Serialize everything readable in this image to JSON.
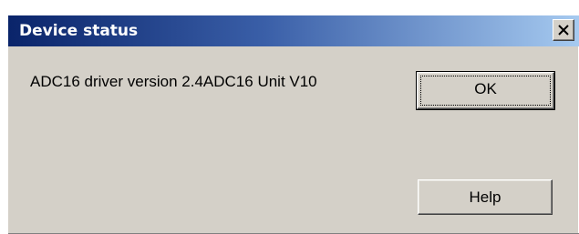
{
  "window": {
    "title": "Device status",
    "close_icon": "close-icon"
  },
  "message": {
    "text": "ADC16 driver version 2.4ADC16 Unit V10"
  },
  "buttons": {
    "ok_label": "OK",
    "help_label": "Help"
  },
  "colors": {
    "titlebar_start": "#0a246a",
    "titlebar_end": "#a6caf0",
    "dialog_face": "#d4d0c8"
  }
}
